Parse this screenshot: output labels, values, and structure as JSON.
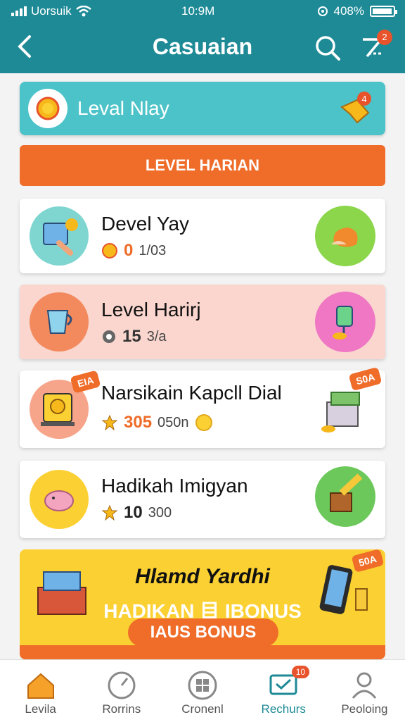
{
  "status": {
    "carrier": "Uorsuik",
    "time": "10:9M",
    "battery": "408%",
    "battery_fill": 0.95
  },
  "header": {
    "title": "Casuaian",
    "back_icon": "chevron-left-icon",
    "notification_badge": "2"
  },
  "level_banner": {
    "label": "Leval Nlay",
    "badge": "4"
  },
  "level_orange": {
    "label": "LEVEL HARIAN"
  },
  "cards": [
    {
      "title": "Devel Yay",
      "num": "0",
      "unit": "1/03"
    },
    {
      "title": "Level Harirj",
      "num": "15",
      "unit": "3/a"
    },
    {
      "title": "Narsikain Kapcll Dial",
      "num": "305",
      "unit": "050n",
      "tag_left": "EIA",
      "tag_right": "S0A"
    },
    {
      "title": "Hadikah Imigyan",
      "num": "10",
      "unit": "300"
    }
  ],
  "bonus": {
    "title": "Hlamd Yardhi",
    "subtitle": "HADIKAN 目 IBONUS",
    "pill": "IAUS BONUS",
    "tag": "50A"
  },
  "tabs": [
    {
      "label": "Levila",
      "icon": "home-icon"
    },
    {
      "label": "Rorrins",
      "icon": "clock-icon"
    },
    {
      "label": "Cronenl",
      "icon": "grid-icon"
    },
    {
      "label": "Rechurs",
      "icon": "chat-icon",
      "badge": "10",
      "active": true
    },
    {
      "label": "Peoloing",
      "icon": "person-icon"
    }
  ],
  "colors": {
    "header": "#1d8a96",
    "accent": "#ef6c29",
    "teal": "#4cc3c9",
    "yellow": "#fbd033"
  }
}
